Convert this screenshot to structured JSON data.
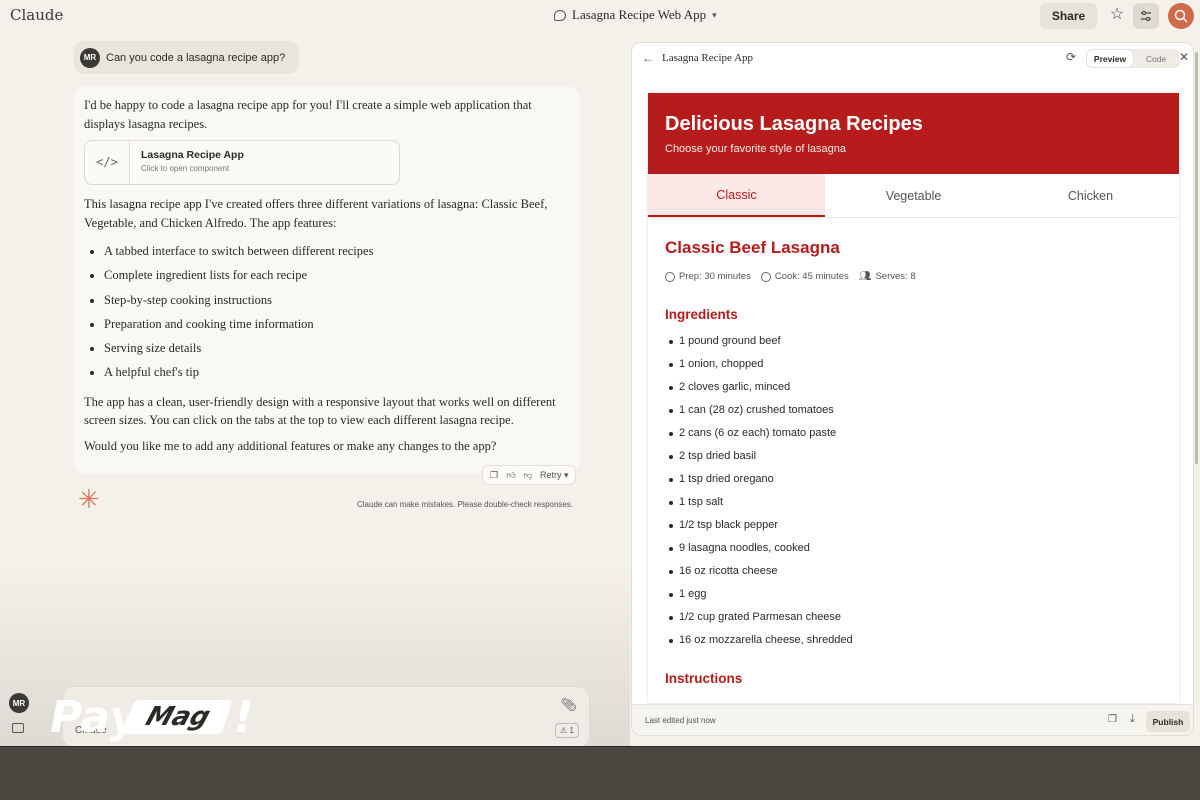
{
  "app": {
    "brand": "Claude"
  },
  "header": {
    "project_title": "Lasagna Recipe Web App",
    "share_label": "Share"
  },
  "chat": {
    "user": {
      "initials": "MR",
      "message": "Can you code a lasagna recipe app?"
    },
    "assistant": {
      "intro": "I'd be happy to code a lasagna recipe app for you! I'll create a simple web application that displays lasagna recipes.",
      "artifact": {
        "title": "Lasagna Recipe App",
        "subtitle": "Click to open component"
      },
      "description": "This lasagna recipe app I've created offers three different variations of lasagna: Classic Beef, Vegetable, and Chicken Alfredo. The app features:",
      "features": [
        "A tabbed interface to switch between different recipes",
        "Complete ingredient lists for each recipe",
        "Step-by-step cooking instructions",
        "Preparation and cooking time information",
        "Serving size details",
        "A helpful chef's tip"
      ],
      "design_note": "The app has a clean, user-friendly design with a responsive layout that works well on different screen sizes. You can click on the tabs at the top to view each different lasagna recipe.",
      "followup": "Would you like me to add any additional features or make any changes to the app?"
    },
    "actions": {
      "retry_label": "Retry"
    },
    "disclaimer": "Claude can make mistakes. Please double-check responses."
  },
  "input": {
    "model_label": "Claude",
    "attachment_count": "1"
  },
  "sidebar": {
    "user_initials": "MR"
  },
  "watermark": {
    "pay": "Pay",
    "mag": "Mag",
    "bang": "!"
  },
  "artifact_panel": {
    "title": "Lasagna Recipe App",
    "toggle": {
      "preview": "Preview",
      "code": "Code"
    },
    "footer": {
      "edited": "Last edited just now",
      "publish_label": "Publish"
    }
  },
  "recipe_app": {
    "heading": "Delicious Lasagna Recipes",
    "subheading": "Choose your favorite style of lasagna",
    "tabs": [
      "Classic",
      "Vegetable",
      "Chicken"
    ],
    "active_tab": "Classic",
    "recipe": {
      "title": "Classic Beef Lasagna",
      "prep": "Prep: 30 minutes",
      "cook": "Cook: 45 minutes",
      "serves": "Serves: 8",
      "ingredients_title": "Ingredients",
      "ingredients": [
        "1 pound ground beef",
        "1 onion, chopped",
        "2 cloves garlic, minced",
        "1 can (28 oz) crushed tomatoes",
        "2 cans (6 oz each) tomato paste",
        "2 tsp dried basil",
        "1 tsp dried oregano",
        "1 tsp salt",
        "1/2 tsp black pepper",
        "9 lasagna noodles, cooked",
        "16 oz ricotta cheese",
        "1 egg",
        "1/2 cup grated Parmesan cheese",
        "16 oz mozzarella cheese, shredded"
      ],
      "instructions_title": "Instructions"
    }
  },
  "colors": {
    "brand_red": "#b71c1c",
    "claude_orange": "#d97757",
    "background": "#f4f1ea"
  }
}
